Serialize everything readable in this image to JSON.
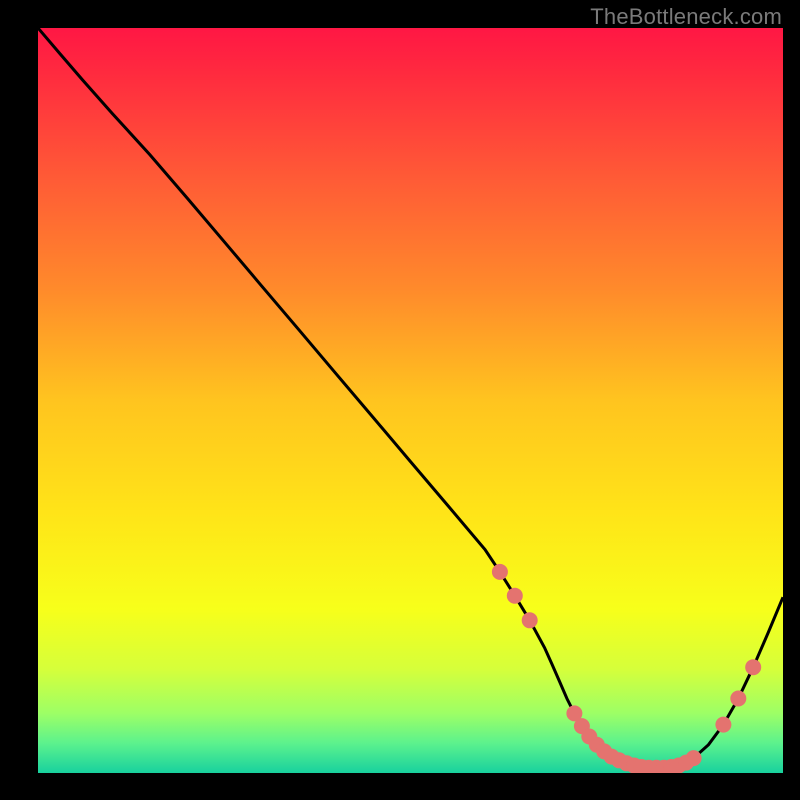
{
  "attribution": "TheBottleneck.com",
  "chart_data": {
    "type": "line",
    "title": "",
    "xlabel": "",
    "ylabel": "",
    "xlim": [
      0,
      100
    ],
    "ylim": [
      0,
      100
    ],
    "gradient_stops": [
      {
        "offset": 0.0,
        "color": "#ff1744"
      },
      {
        "offset": 0.06,
        "color": "#ff2a3f"
      },
      {
        "offset": 0.2,
        "color": "#ff5a36"
      },
      {
        "offset": 0.35,
        "color": "#ff8a2b"
      },
      {
        "offset": 0.5,
        "color": "#ffc41f"
      },
      {
        "offset": 0.65,
        "color": "#ffe418"
      },
      {
        "offset": 0.78,
        "color": "#f7ff1a"
      },
      {
        "offset": 0.86,
        "color": "#d6ff3a"
      },
      {
        "offset": 0.92,
        "color": "#9dff66"
      },
      {
        "offset": 0.96,
        "color": "#5cf28d"
      },
      {
        "offset": 1.0,
        "color": "#18d19e"
      }
    ],
    "series": [
      {
        "name": "curve",
        "color": "#000000",
        "x": [
          0,
          3,
          6,
          10,
          15,
          20,
          25,
          30,
          35,
          40,
          45,
          50,
          55,
          60,
          62,
          64,
          66,
          68,
          69,
          70,
          71,
          72,
          73,
          74,
          75,
          76,
          77,
          78,
          79,
          80,
          81,
          82,
          83,
          84,
          85,
          86,
          87,
          88,
          90,
          92,
          94,
          96,
          98,
          100
        ],
        "y": [
          100,
          96.5,
          93.0,
          88.5,
          83.0,
          77.2,
          71.3,
          65.4,
          59.5,
          53.6,
          47.7,
          41.8,
          35.9,
          30.0,
          27.0,
          23.8,
          20.5,
          16.8,
          14.6,
          12.3,
          10.0,
          8.0,
          6.3,
          4.9,
          3.8,
          2.9,
          2.2,
          1.7,
          1.3,
          1.0,
          0.8,
          0.7,
          0.7,
          0.7,
          0.8,
          1.0,
          1.4,
          2.0,
          3.8,
          6.5,
          10.0,
          14.2,
          18.8,
          23.6
        ]
      }
    ],
    "dots": {
      "name": "markers",
      "color": "#e4736f",
      "x": [
        62,
        64,
        66,
        72,
        73,
        74,
        75,
        76,
        77,
        78,
        79,
        80,
        81,
        82,
        83,
        84,
        85,
        86,
        87,
        88,
        92,
        94,
        96
      ],
      "y": [
        27.0,
        23.8,
        20.5,
        8.0,
        6.3,
        4.9,
        3.8,
        2.9,
        2.2,
        1.7,
        1.3,
        1.0,
        0.8,
        0.7,
        0.7,
        0.7,
        0.8,
        1.0,
        1.4,
        2.0,
        6.5,
        10.0,
        14.2
      ]
    }
  }
}
